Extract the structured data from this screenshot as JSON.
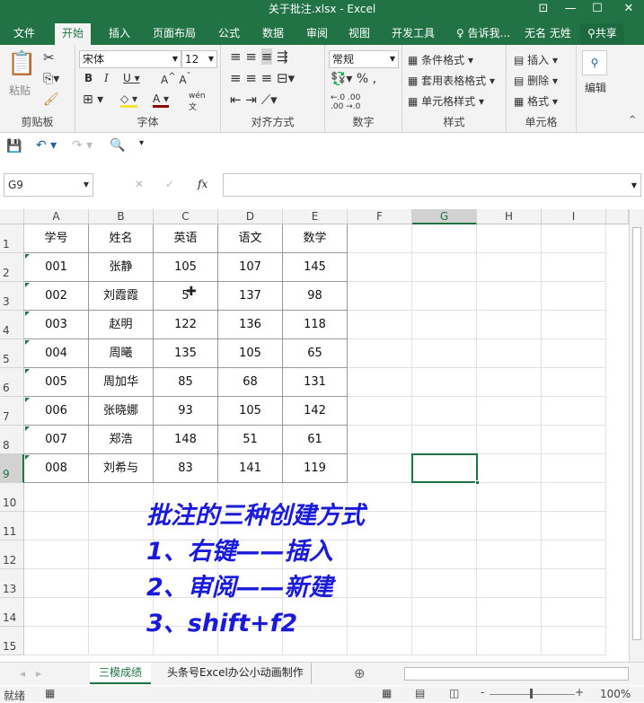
{
  "title": "关于批注.xlsx - Excel",
  "tabs": [
    "文件",
    "开始",
    "插入",
    "页面布局",
    "公式",
    "数据",
    "审阅",
    "视图",
    "开发工具"
  ],
  "tell_me": "告诉我...",
  "user": "无名 无姓",
  "share": "共享",
  "ribbon": {
    "paste": "粘贴",
    "clipboard": "剪贴板",
    "font_name": "宋体",
    "font_size": "12",
    "font_group": "字体",
    "align_group": "对齐方式",
    "number_format": "常规",
    "number_group": "数字",
    "cond_format": "条件格式",
    "table_format": "套用表格格式",
    "cell_style": "单元格样式",
    "styles_group": "样式",
    "insert": "插入",
    "delete": "删除",
    "format": "格式",
    "cells_group": "单元格",
    "edit": "编辑"
  },
  "name_box": "G9",
  "fx": "fx",
  "columns": [
    "A",
    "B",
    "C",
    "D",
    "E",
    "F",
    "G",
    "H",
    "I"
  ],
  "rows": [
    "1",
    "2",
    "3",
    "4",
    "5",
    "6",
    "7",
    "8",
    "9",
    "10",
    "11",
    "12",
    "13",
    "14",
    "15"
  ],
  "table": [
    [
      "学号",
      "姓名",
      "英语",
      "语文",
      "数学"
    ],
    [
      "001",
      "张静",
      "105",
      "107",
      "145"
    ],
    [
      "002",
      "刘霞霞",
      "5",
      "137",
      "98"
    ],
    [
      "003",
      "赵明",
      "122",
      "136",
      "118"
    ],
    [
      "004",
      "周曦",
      "135",
      "105",
      "65"
    ],
    [
      "005",
      "周加华",
      "85",
      "68",
      "131"
    ],
    [
      "006",
      "张晓娜",
      "93",
      "105",
      "142"
    ],
    [
      "007",
      "郑浩",
      "148",
      "51",
      "61"
    ],
    [
      "008",
      "刘希与",
      "83",
      "141",
      "119"
    ]
  ],
  "notes": [
    "批注的三种创建方式",
    "1、右键——插入",
    "2、审阅——新建",
    "3、shift+f2"
  ],
  "sheets": [
    "三模成绩",
    "头条号Excel办公小动画制作"
  ],
  "status": "就绪",
  "zoom": "100%"
}
